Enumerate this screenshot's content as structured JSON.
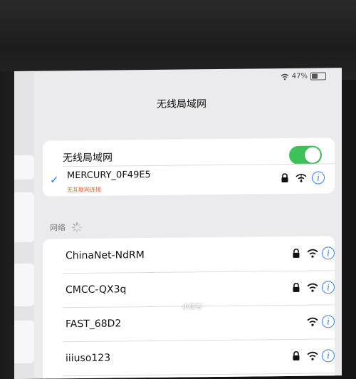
{
  "status": {
    "battery": "47%",
    "wifi_icon": "wifi-icon"
  },
  "nav": {
    "title": "无线局域网"
  },
  "wifi_toggle": {
    "label": "无线局域网",
    "state": "on",
    "color": "#3fc15a"
  },
  "connected": {
    "name": "MERCURY_0F49E5",
    "subtitle": "无互联网连接",
    "subtitle_color": "#e0602a",
    "secure": true
  },
  "networks_section": {
    "label": "网络"
  },
  "networks": [
    {
      "name": "ChinaNet-NdRM",
      "secure": true
    },
    {
      "name": "CMCC-QX3q",
      "secure": true
    },
    {
      "name": "FAST_68D2",
      "secure": false
    },
    {
      "name": "iiiuso123",
      "secure": true
    }
  ],
  "watermark": "小红书",
  "accent": "#2d7bf6"
}
